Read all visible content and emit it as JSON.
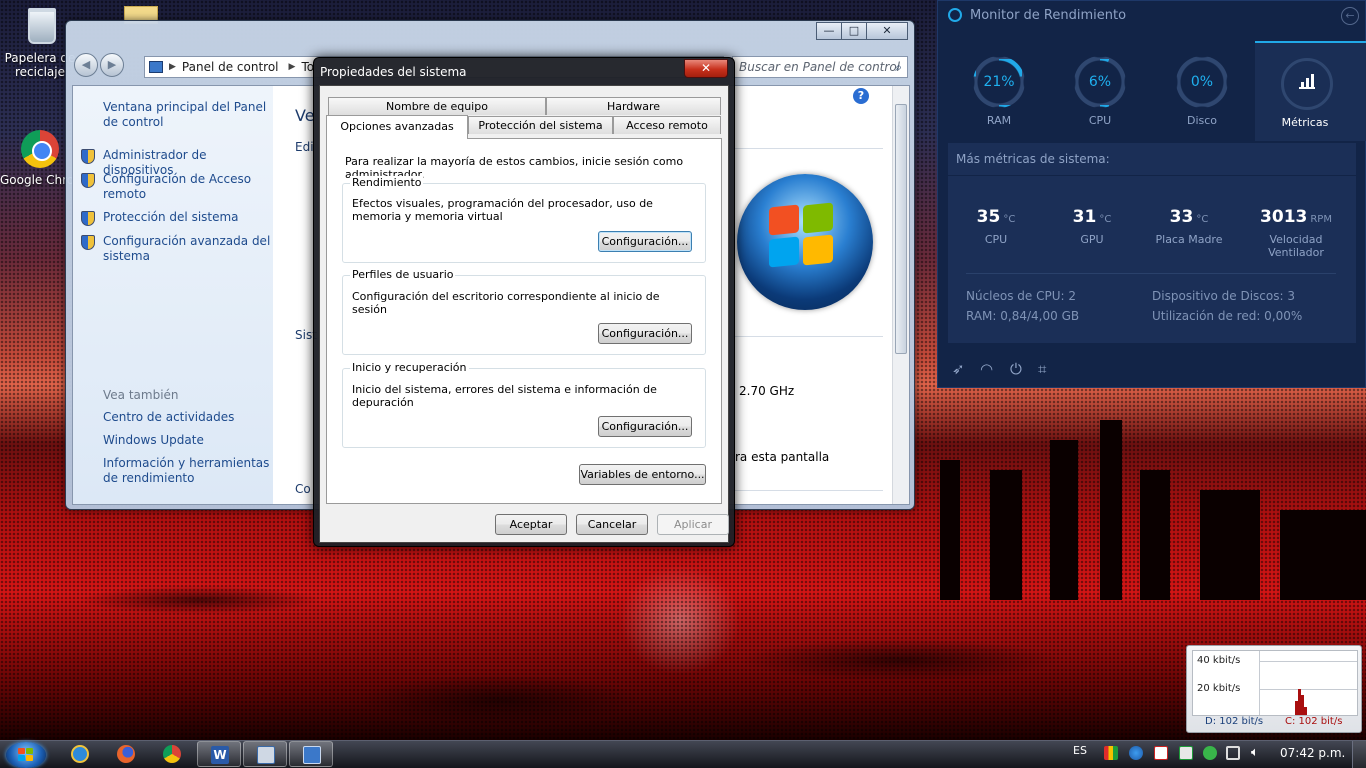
{
  "desktop": {
    "icons": [
      {
        "label": "Papelera de reciclaje"
      },
      {
        "label": "Google Chrome"
      }
    ]
  },
  "control_panel": {
    "address": [
      "Panel de control",
      "To"
    ],
    "search_placeholder": "Buscar en Panel de control",
    "left_links": [
      "Ventana principal del Panel de control",
      "Administrador de dispositivos",
      "Configuración de Acceso remoto",
      "Protección del sistema",
      "Configuración avanzada del sistema"
    ],
    "see_also_title": "Vea también",
    "see_also": [
      "Centro de actividades",
      "Windows Update",
      "Información y herramientas de rendimiento"
    ],
    "main_fragments": {
      "heading": "Ve",
      "edition": "Edi",
      "system": "Sist",
      "computer": "Co",
      "speed": "2.70 GHz",
      "screen": "ra esta pantalla"
    },
    "help": "?"
  },
  "dialog": {
    "title": "Propiedades del sistema",
    "close": "✕",
    "tabs_row1": [
      "Nombre de equipo",
      "Hardware"
    ],
    "tabs_row2": [
      "Opciones avanzadas",
      "Protección del sistema",
      "Acceso remoto"
    ],
    "admin_note": "Para realizar la mayoría de estos cambios, inicie sesión como administrador.",
    "groups": [
      {
        "legend": "Rendimiento",
        "text": "Efectos visuales, programación del procesador, uso de memoria y memoria virtual",
        "button": "Configuración..."
      },
      {
        "legend": "Perfiles de usuario",
        "text": "Configuración del escritorio correspondiente al inicio de sesión",
        "button": "Configuración..."
      },
      {
        "legend": "Inicio y recuperación",
        "text": "Inicio del sistema, errores del sistema e información de depuración",
        "button": "Configuración..."
      }
    ],
    "env_button": "Variables de entorno...",
    "ok": "Aceptar",
    "cancel": "Cancelar",
    "apply": "Aplicar"
  },
  "monitor": {
    "title": "Monitor de Rendimiento",
    "gauges": [
      {
        "value": "21%",
        "label": "RAM",
        "fraction": 0.21
      },
      {
        "value": "6%",
        "label": "CPU",
        "fraction": 0.06
      },
      {
        "value": "0%",
        "label": "Disco",
        "fraction": 0.0
      }
    ],
    "metrics_tab": "Métricas",
    "subtitle": "Más métricas de sistema:",
    "temps": [
      {
        "value": "35",
        "unit": "°C",
        "label": "CPU"
      },
      {
        "value": "31",
        "unit": "°C",
        "label": "GPU"
      },
      {
        "value": "33",
        "unit": "°C",
        "label": "Placa Madre"
      },
      {
        "value": "3013",
        "unit": "RPM",
        "label": "Velocidad Ventilador"
      }
    ],
    "stats": {
      "cores": "Núcleos de CPU: 2",
      "disks": "Dispositivo de Discos: 3",
      "ram": "RAM: 0,84/4,00 GB",
      "net": "Utilización de red: 0,00%"
    },
    "accent": "#21a9e8"
  },
  "network_meter": {
    "top_label": "40 kbit/s",
    "mid_label": "20 kbit/s",
    "down": "D: 102 bit/s",
    "up": "C: 102 bit/s"
  },
  "taskbar": {
    "language": "ES",
    "clock": "07:42 p.m."
  }
}
